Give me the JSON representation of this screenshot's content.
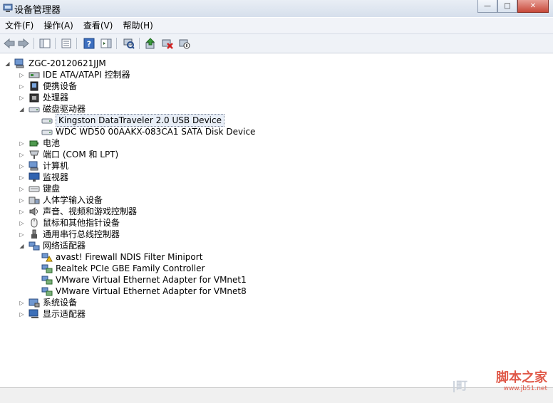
{
  "window": {
    "title": "设备管理器",
    "min_glyph": "—",
    "max_glyph": "□",
    "close_glyph": "✕"
  },
  "menu": [
    "文件(F)",
    "操作(A)",
    "查看(V)",
    "帮助(H)"
  ],
  "tree": {
    "root": "ZGC-20120621JJM",
    "items": [
      {
        "label": "IDE ATA/ATAPI 控制器",
        "icon": "ide-controller-icon",
        "expanded": false
      },
      {
        "label": "便携设备",
        "icon": "portable-device-icon",
        "expanded": false
      },
      {
        "label": "处理器",
        "icon": "processor-icon",
        "expanded": false
      },
      {
        "label": "磁盘驱动器",
        "icon": "disk-drive-icon",
        "expanded": true,
        "children": [
          {
            "label": "Kingston DataTraveler 2.0 USB Device",
            "icon": "disk-icon",
            "selected": true
          },
          {
            "label": "WDC WD50 00AAKX-083CA1 SATA Disk Device",
            "icon": "disk-icon"
          }
        ]
      },
      {
        "label": "电池",
        "icon": "battery-icon",
        "expanded": false
      },
      {
        "label": "端口 (COM 和 LPT)",
        "icon": "port-icon",
        "expanded": false
      },
      {
        "label": "计算机",
        "icon": "computer-icon",
        "expanded": false
      },
      {
        "label": "监视器",
        "icon": "monitor-icon",
        "expanded": false
      },
      {
        "label": "键盘",
        "icon": "keyboard-icon",
        "expanded": false
      },
      {
        "label": "人体学输入设备",
        "icon": "hid-icon",
        "expanded": false
      },
      {
        "label": "声音、视频和游戏控制器",
        "icon": "sound-icon",
        "expanded": false
      },
      {
        "label": "鼠标和其他指针设备",
        "icon": "mouse-icon",
        "expanded": false
      },
      {
        "label": "通用串行总线控制器",
        "icon": "usb-icon",
        "expanded": false
      },
      {
        "label": "网络适配器",
        "icon": "network-adapter-icon",
        "expanded": true,
        "children": [
          {
            "label": "avast! Firewall NDIS Filter Miniport",
            "icon": "network-warning-icon"
          },
          {
            "label": "Realtek PCIe GBE Family Controller",
            "icon": "network-card-icon"
          },
          {
            "label": "VMware Virtual Ethernet Adapter for VMnet1",
            "icon": "network-card-icon"
          },
          {
            "label": "VMware Virtual Ethernet Adapter for VMnet8",
            "icon": "network-card-icon"
          }
        ]
      },
      {
        "label": "系统设备",
        "icon": "system-device-icon",
        "expanded": false
      },
      {
        "label": "显示适配器",
        "icon": "display-adapter-icon",
        "expanded": false
      }
    ]
  },
  "watermark": {
    "main": "脚本之家",
    "sub": "www.jb51.net",
    "left": "|町"
  }
}
